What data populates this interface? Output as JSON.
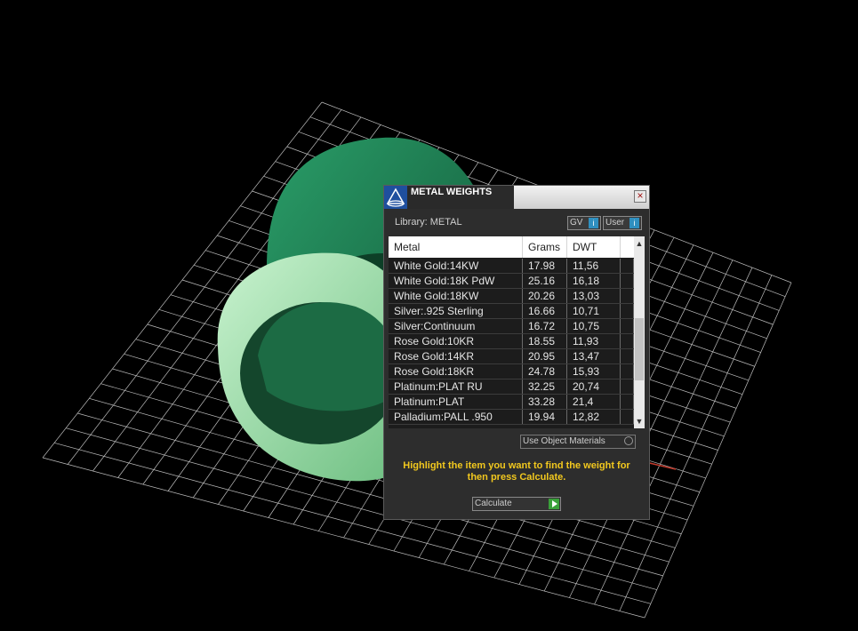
{
  "panel": {
    "title": "METAL WEIGHTS",
    "close_icon": "close-icon",
    "library_label": "Library: METAL",
    "gv_label": "GV",
    "user_label": "User",
    "info_glyph": "i",
    "table": {
      "headers": [
        "Metal",
        "Grams",
        "DWT"
      ],
      "rows": [
        {
          "metal": "White Gold:14KW",
          "grams": "17.98",
          "dwt": "11,56"
        },
        {
          "metal": "White Gold:18K PdW",
          "grams": "25.16",
          "dwt": "16,18"
        },
        {
          "metal": "White Gold:18KW",
          "grams": "20.26",
          "dwt": "13,03"
        },
        {
          "metal": "Silver:.925 Sterling",
          "grams": "16.66",
          "dwt": "10,71"
        },
        {
          "metal": "Silver:Continuum",
          "grams": "16.72",
          "dwt": "10,75"
        },
        {
          "metal": "Rose Gold:10KR",
          "grams": "18.55",
          "dwt": "11,93"
        },
        {
          "metal": "Rose Gold:14KR",
          "grams": "20.95",
          "dwt": "13,47"
        },
        {
          "metal": "Rose Gold:18KR",
          "grams": "24.78",
          "dwt": "15,93"
        },
        {
          "metal": "Platinum:PLAT RU",
          "grams": "32.25",
          "dwt": "20,74"
        },
        {
          "metal": "Platinum:PLAT",
          "grams": "33.28",
          "dwt": "21,4"
        },
        {
          "metal": "Palladium:PALL .950",
          "grams": "19.94",
          "dwt": "12,82"
        }
      ]
    },
    "use_object_materials_label": "Use Object Materials",
    "hint": "Highlight the item you want to find the weight for then press Calculate.",
    "calculate_label": "Calculate"
  },
  "colors": {
    "background": "#000000",
    "grid": "#bdbdbd",
    "ring_dark": "#1f7a4f",
    "ring_light": "#a8e0b0",
    "hint_text": "#f2c81e"
  }
}
